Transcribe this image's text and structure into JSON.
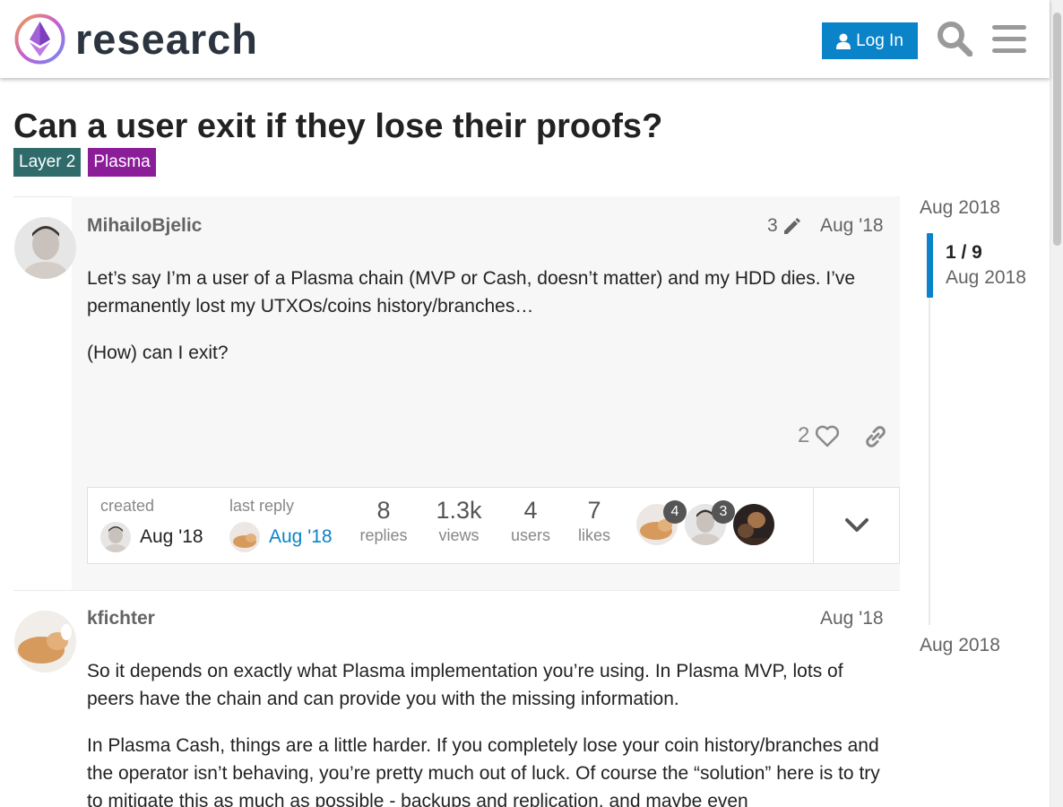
{
  "header": {
    "logo_text": "research",
    "login_label": "Log In"
  },
  "topic": {
    "title": "Can a user exit if they lose their proofs?",
    "tags": [
      "Layer 2",
      "Plasma"
    ]
  },
  "posts": [
    {
      "username": "MihailoBjelic",
      "date": "Aug '18",
      "edit_count": "3",
      "paragraphs": [
        "Let’s say I’m a user of a Plasma chain (MVP or Cash, doesn’t matter) and my HDD dies. I’ve permanently lost my UTXOs/coins history/branches…",
        "(How) can I exit?"
      ],
      "like_count": "2"
    },
    {
      "username": "kfichter",
      "date": "Aug '18",
      "paragraphs": [
        "So it depends on exactly what Plasma implementation you’re using. In Plasma MVP, lots of peers have the chain and can provide you with the missing information.",
        "In Plasma Cash, things are a little harder. If you completely lose your coin history/branches and the operator isn’t behaving, you’re pretty much out of luck. Of course the “solution” here is to try to mitigate this as much as possible - backups and replication, and maybe even"
      ]
    }
  ],
  "topic_map": {
    "created_label": "created",
    "created_date": "Aug '18",
    "last_reply_label": "last reply",
    "last_reply_date": "Aug '18",
    "replies": "8",
    "replies_label": "replies",
    "views": "1.3k",
    "views_label": "views",
    "users": "4",
    "users_label": "users",
    "likes": "7",
    "likes_label": "likes",
    "participant_counts": [
      "4",
      "3"
    ]
  },
  "timeline": {
    "start_date": "Aug 2018",
    "position": "1 / 9",
    "position_date": "Aug 2018",
    "end_date": "Aug 2018",
    "progress_fraction": 0.11
  },
  "colors": {
    "accent": "#0a83c9",
    "tag_layer2": "#2f6b6b",
    "tag_plasma": "#8c1d99"
  }
}
